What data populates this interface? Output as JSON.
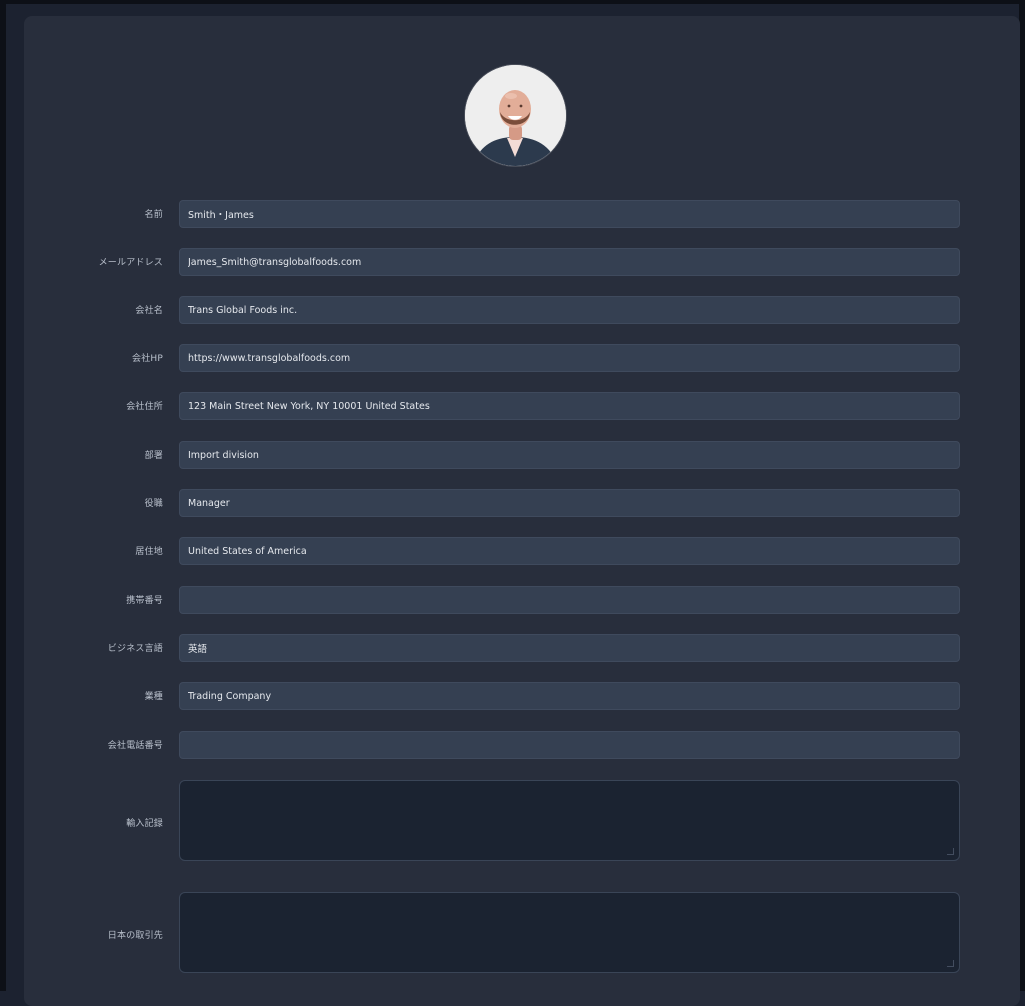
{
  "profile": {
    "avatar_icon": "person-photo-avatar"
  },
  "form": {
    "fields": [
      {
        "key": "name",
        "label": "名前",
        "value": "Smith・James"
      },
      {
        "key": "email",
        "label": "メールアドレス",
        "value": "James_Smith@transglobalfoods.com"
      },
      {
        "key": "company",
        "label": "会社名",
        "value": "Trans Global Foods inc."
      },
      {
        "key": "company_hp",
        "label": "会社HP",
        "value": "https://www.transglobalfoods.com"
      },
      {
        "key": "company_address",
        "label": "会社住所",
        "value": "123 Main Street New York, NY 10001 United States"
      },
      {
        "key": "department",
        "label": "部署",
        "value": "Import division"
      },
      {
        "key": "position",
        "label": "役職",
        "value": "Manager"
      },
      {
        "key": "residence",
        "label": "居住地",
        "value": "United States of America"
      },
      {
        "key": "mobile",
        "label": "携帯番号",
        "value": ""
      },
      {
        "key": "business_language",
        "label": "ビジネス言語",
        "value": "英語"
      },
      {
        "key": "industry",
        "label": "業種",
        "value": "Trading Company"
      },
      {
        "key": "company_phone",
        "label": "会社電話番号",
        "value": ""
      }
    ],
    "textareas": [
      {
        "key": "import_record",
        "label": "輸入記録",
        "value": ""
      },
      {
        "key": "japan_partners",
        "label": "日本の取引先",
        "value": ""
      }
    ]
  }
}
